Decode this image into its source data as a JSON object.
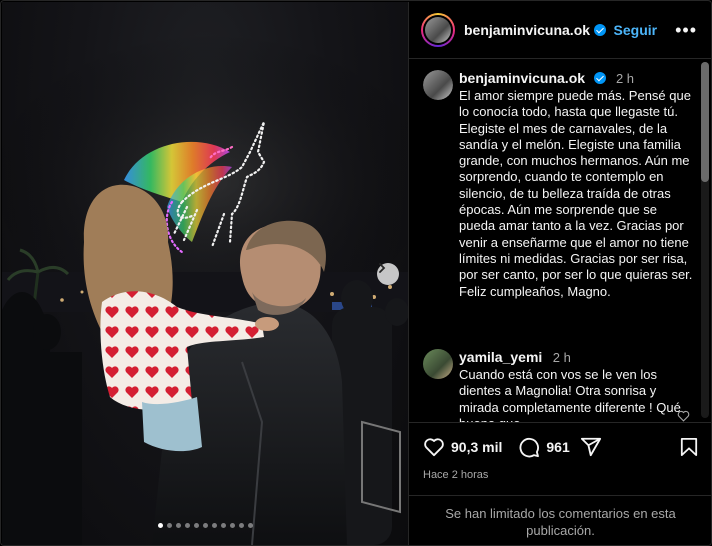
{
  "post": {
    "username": "benjaminvicuna.ok",
    "follow_label": "Seguir",
    "more_label": "•••",
    "caption_time": "2 h",
    "caption_text": "El amor siempre puede más. Pensé que lo conocía todo, hasta que llegaste tú. Elegiste el mes de carnavales, de la sandía y el melón. Elegiste una familia grande, con muchos hermanos. Aún me sorprendo, cuando te contemplo en silencio, de tu belleza traída de otras épocas. Aún me sorprende que se pueda amar tanto a la vez. Gracias por venir a enseñarme que el amor no tiene límites ni medidas. Gracias por ser risa, por ser canto, por ser lo que quieras ser.\nFeliz cumpleaños, Magno.",
    "likes": "90,3 mil",
    "comments_count": "961",
    "posted_ago": "Hace 2 horas",
    "comments_limited": "Se han limitado los comentarios en esta publicación."
  },
  "reply": {
    "username": "yamila_yemi",
    "time": "2 h",
    "text": "Cuando está con vos se le ven los dientes a Magnolia! Otra sonrisa y mirada completamente diferente ! Qué bueno que"
  },
  "carousel": {
    "total": 11,
    "active_index": 0
  },
  "icons": {
    "like": "heart-icon",
    "comment": "comment-icon",
    "share": "share-icon",
    "save": "bookmark-icon",
    "next": "chevron-right-icon",
    "verified": "verified-badge-icon"
  },
  "colors": {
    "accent": "#4cb5f9",
    "verified": "#0095f6",
    "background": "#000000",
    "muted_text": "#a8a8a8"
  }
}
